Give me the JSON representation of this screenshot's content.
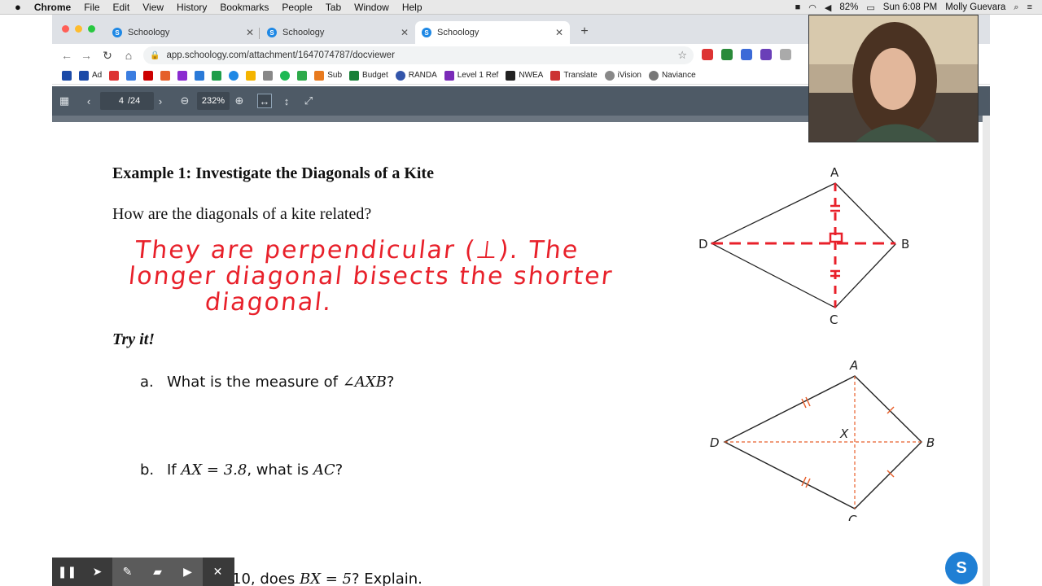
{
  "menubar": {
    "app": "Chrome",
    "items": [
      "File",
      "Edit",
      "View",
      "History",
      "Bookmarks",
      "People",
      "Tab",
      "Window",
      "Help"
    ],
    "battery": "82%",
    "clock": "Sun 6:08 PM",
    "user": "Molly Guevara"
  },
  "tabs": [
    {
      "title": "Schoology"
    },
    {
      "title": "Schoology"
    },
    {
      "title": "Schoology"
    }
  ],
  "toolbar": {
    "url": "app.schoology.com/attachment/1647074787/docviewer"
  },
  "bookmarks": [
    "Ad",
    "Sub",
    "Budget",
    "RANDA",
    "Level 1 Ref",
    "NWEA",
    "Translate",
    "iVision",
    "Naviance"
  ],
  "viewer": {
    "page_current": "4",
    "page_total": "/24",
    "zoom": "232%"
  },
  "document": {
    "heading": "Example 1: Investigate the Diagonals of a Kite",
    "question": "How are the diagonals of a kite related?",
    "handwriting": [
      "They are perpendicular (⊥). The",
      "longer diagonal bisects the shorter",
      "diagonal."
    ],
    "try_it": "Try it!",
    "questions": [
      {
        "label": "a.",
        "text_before": "What is the measure of ",
        "math": "∠AXB",
        "text_after": "?"
      },
      {
        "label": "b.",
        "text_before": "If ",
        "math": "AX = 3.8",
        "text_after": ", what is ",
        "math2": "AC",
        "text_after2": "?"
      },
      {
        "label": "",
        "text_before": "10, does ",
        "math": "BX = 5",
        "text_after": "? Explain."
      }
    ],
    "diagram1_labels": {
      "A": "A",
      "B": "B",
      "C": "C",
      "D": "D"
    },
    "diagram2_labels": {
      "A": "A",
      "B": "B",
      "C": "C",
      "D": "D",
      "X": "X"
    }
  },
  "help_label": "S",
  "colors": {
    "accent_red": "#e8202a",
    "diagram_orange": "#e8602c",
    "viewer_bar": "#4e5a66",
    "help_blue": "#1f7fd4"
  },
  "icons": [
    "apple-icon",
    "search-icon",
    "wifi-icon",
    "battery-icon",
    "reload-icon",
    "home-icon",
    "lock-icon",
    "star-icon",
    "grid-icon",
    "zoom-out-icon",
    "zoom-in-icon",
    "fit-width-icon",
    "fit-height-icon",
    "fullscreen-icon",
    "pause-icon",
    "pointer-icon",
    "pen-icon",
    "highlighter-icon",
    "camera-icon",
    "close-icon"
  ]
}
